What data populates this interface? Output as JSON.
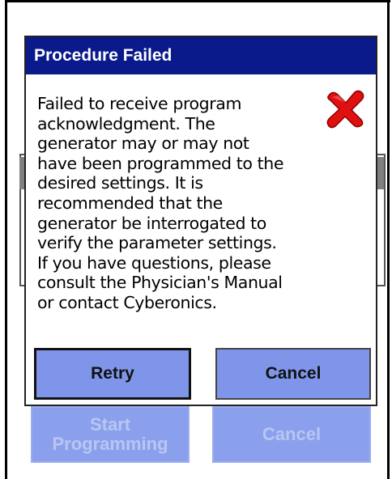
{
  "background": {
    "start_button_label": "Start\nProgramming",
    "cancel_button_label": "Cancel"
  },
  "dialog": {
    "title": "Procedure Failed",
    "message": "Failed to receive program\nacknowledgment.  The\ngenerator may or may not\nhave been programmed to the\ndesired settings. It is\nrecommended that the\ngenerator be interrogated to\nverify the parameter settings.\nIf you have questions, please\nconsult the Physician's Manual\nor contact Cyberonics.",
    "icon": "error-x-icon",
    "retry_label": "Retry",
    "cancel_label": "Cancel"
  },
  "colors": {
    "title_bar": "#0a1a8a",
    "button": "#7f95ea",
    "error_icon": "#e01010"
  }
}
